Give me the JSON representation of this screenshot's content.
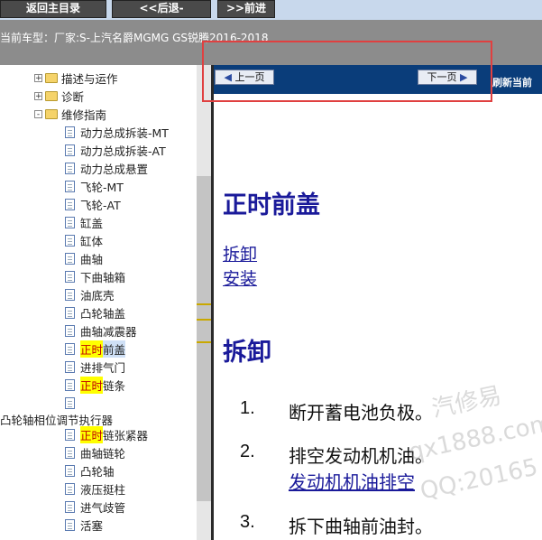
{
  "nav": {
    "home": "返回主目录",
    "back": "<<后退-",
    "forward": ">>前进"
  },
  "vehicle": {
    "label": "当前车型：",
    "value": "厂家:S-上汽名爵MGMG GS锐腾2016-2018"
  },
  "tree": {
    "top_items": [
      {
        "label": "描述与运作",
        "expander": "+"
      },
      {
        "label": "诊断",
        "expander": "+"
      },
      {
        "label": "维修指南",
        "expander": "-"
      }
    ],
    "children": [
      {
        "label": "动力总成拆装-MT"
      },
      {
        "label": "动力总成拆装-AT"
      },
      {
        "label": "动力总成悬置"
      },
      {
        "label": "飞轮-MT"
      },
      {
        "label": "飞轮-AT"
      },
      {
        "label": "缸盖"
      },
      {
        "label": "缸体"
      },
      {
        "label": "曲轴"
      },
      {
        "label": "下曲轴箱"
      },
      {
        "label": "油底壳"
      },
      {
        "label": "凸轮轴盖"
      },
      {
        "label": "曲轴减震器"
      }
    ],
    "selected": {
      "hl": "正时",
      "rest": "前盖"
    },
    "after_selected": {
      "label": "进排气门"
    },
    "chain": {
      "hl": "正时",
      "rest": "链条"
    },
    "group_label": "凸轮轴相位调节执行器",
    "tensioner": {
      "hl": "正时",
      "rest": "链张紧器"
    },
    "more": [
      {
        "label": "曲轴链轮"
      },
      {
        "label": "凸轮轴"
      },
      {
        "label": "液压挺柱"
      },
      {
        "label": "进气歧管"
      },
      {
        "label": "活塞"
      }
    ]
  },
  "pager": {
    "prev": "上一页",
    "next": "下一页",
    "refresh": "刷新当前"
  },
  "content": {
    "title": "正时前盖",
    "links": [
      "拆卸",
      "安装"
    ],
    "section": "拆卸",
    "steps": [
      {
        "num": "1.",
        "text": "断开蓄电池负极。"
      },
      {
        "num": "2.",
        "text": "排空发动机机油。",
        "link": "发动机机油排空"
      },
      {
        "num": "3.",
        "text": "拆下曲轴前油封。"
      }
    ]
  },
  "watermark": [
    "汽修易",
    "qx1888.com",
    "QQ:20165"
  ]
}
